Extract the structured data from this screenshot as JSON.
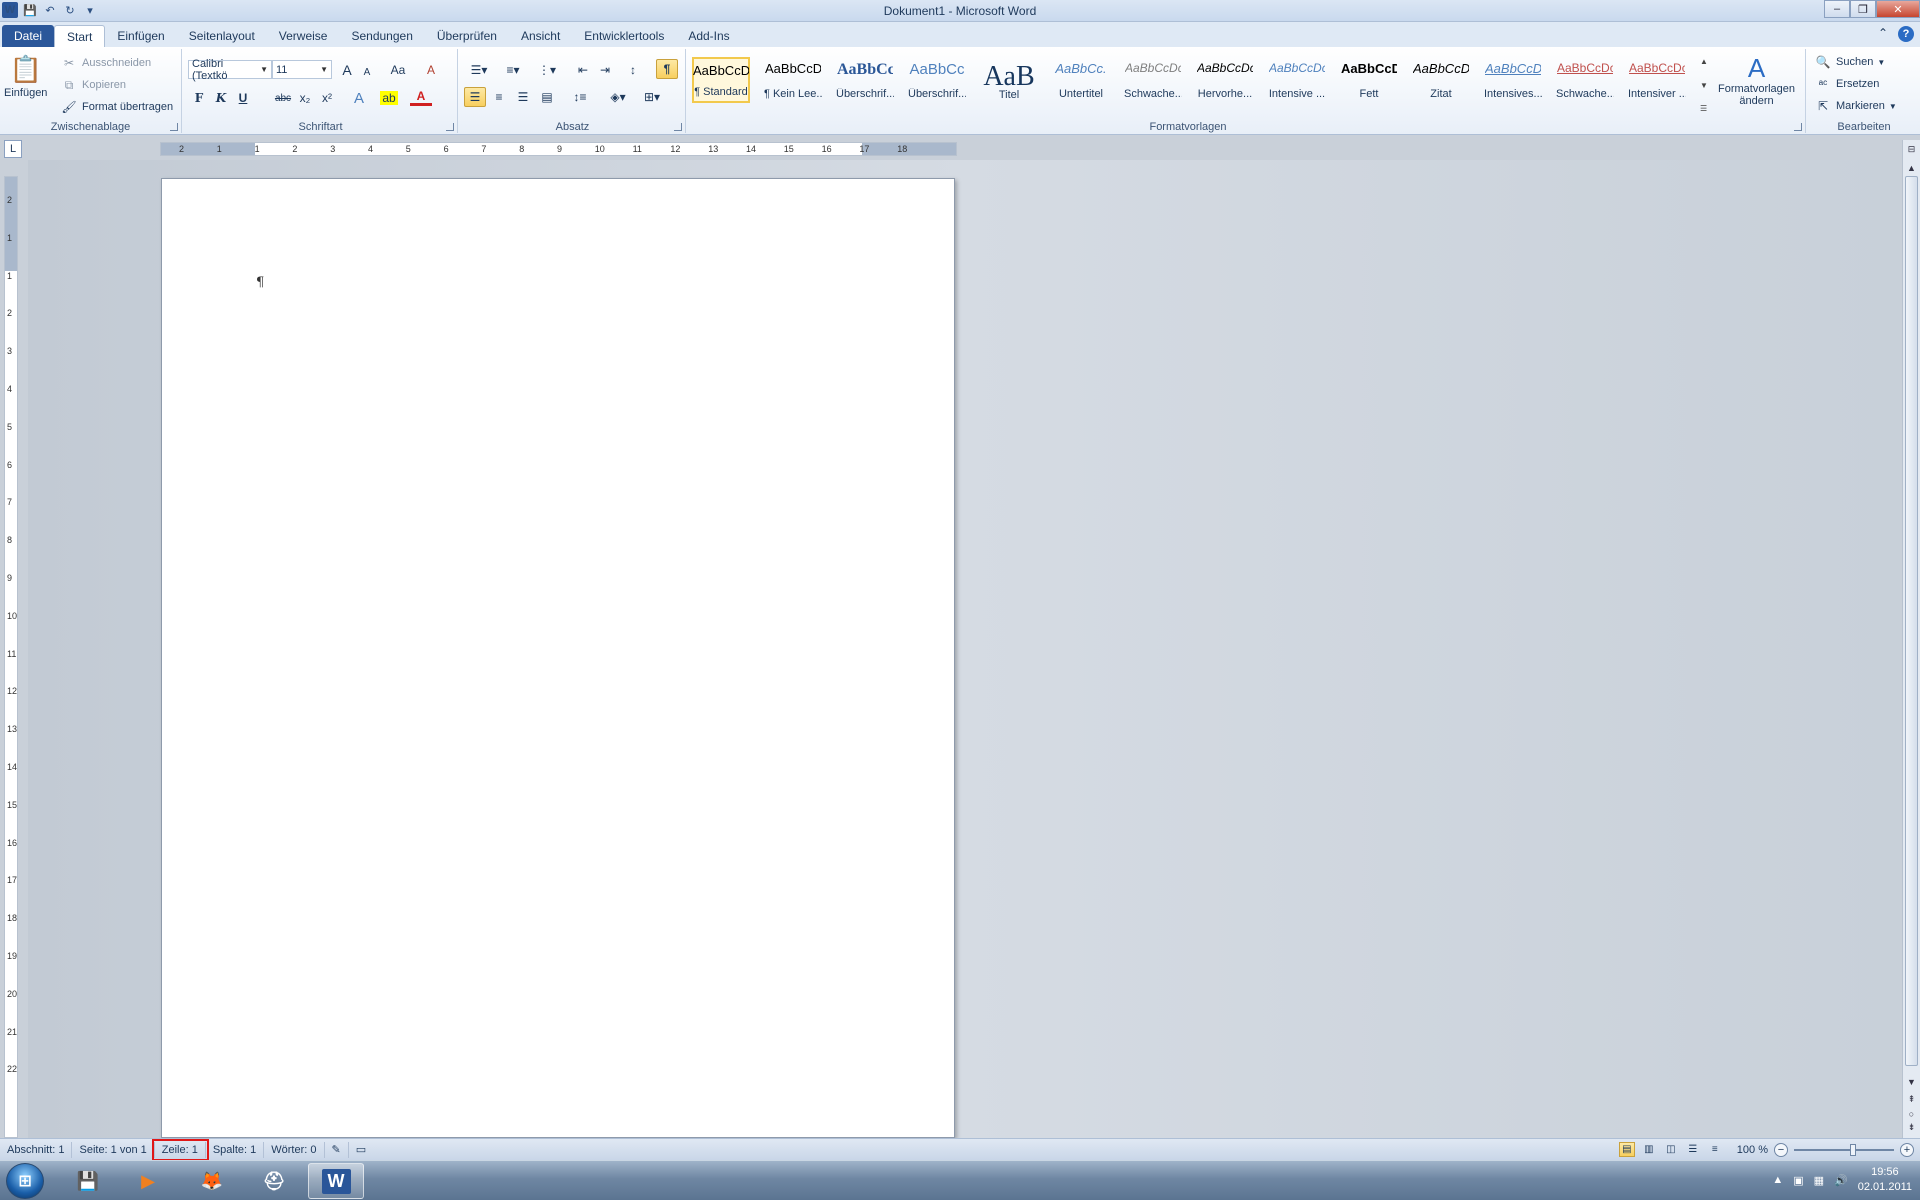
{
  "window": {
    "title": "Dokument1 - Microsoft Word",
    "minimize": "–",
    "maximize": "❐",
    "close": "✕"
  },
  "qat": {
    "word_logo": "W",
    "save_icon": "💾",
    "undo_icon": "↶",
    "redo_icon": "↻",
    "customize_icon": "▾"
  },
  "tabs": [
    {
      "label": "Datei"
    },
    {
      "label": "Start"
    },
    {
      "label": "Einfügen"
    },
    {
      "label": "Seitenlayout"
    },
    {
      "label": "Verweise"
    },
    {
      "label": "Sendungen"
    },
    {
      "label": "Überprüfen"
    },
    {
      "label": "Ansicht"
    },
    {
      "label": "Entwicklertools"
    },
    {
      "label": "Add-Ins"
    }
  ],
  "help": "?",
  "ribbon": {
    "clipboard": {
      "label": "Zwischenablage",
      "paste": "Einfügen",
      "cut": "Ausschneiden",
      "copy": "Kopieren",
      "format_painter": "Format übertragen"
    },
    "font": {
      "label": "Schriftart",
      "font_name": "Calibri (Textkö",
      "font_size": "11",
      "bold": "F",
      "italic": "K",
      "underline": "U",
      "strike": "abc",
      "subscript": "x₂",
      "superscript": "x²",
      "grow": "A",
      "shrink": "A",
      "case": "Aa",
      "clear": "A"
    },
    "paragraph": {
      "label": "Absatz",
      "pilcrow": "¶"
    },
    "styles": {
      "label": "Formatvorlagen",
      "items": [
        {
          "sample": "AaBbCcDc",
          "name": "¶ Standard",
          "color": "#000000"
        },
        {
          "sample": "AaBbCcDc",
          "name": "¶ Kein Lee...",
          "color": "#000000"
        },
        {
          "sample": "AaBbCc",
          "name": "Überschrif...",
          "color": "#2b5797"
        },
        {
          "sample": "AaBbCc",
          "name": "Überschrif...",
          "color": "#4f81bd"
        },
        {
          "sample": "AaB",
          "name": "Titel",
          "color": "#17365d"
        },
        {
          "sample": "AaBbCc.",
          "name": "Untertitel",
          "color": "#4f81bd"
        },
        {
          "sample": "AaBbCcDc",
          "name": "Schwache...",
          "color": "#7f7f7f"
        },
        {
          "sample": "AaBbCcDc",
          "name": "Hervorhe...",
          "color": "#000000"
        },
        {
          "sample": "AaBbCcDc",
          "name": "Intensive ...",
          "color": "#4f81bd"
        },
        {
          "sample": "AaBbCcDc",
          "name": "Fett",
          "color": "#000000"
        },
        {
          "sample": "AaBbCcDc",
          "name": "Zitat",
          "color": "#000000"
        },
        {
          "sample": "AaBbCcDc",
          "name": "Intensives...",
          "color": "#4f81bd"
        },
        {
          "sample": "AaBbCcDc",
          "name": "Schwache...",
          "color": "#c0504d"
        },
        {
          "sample": "AaBbCcDc",
          "name": "Intensiver ...",
          "color": "#c0504d"
        }
      ],
      "change_label_1": "Formatvorlagen",
      "change_label_2": "ändern"
    },
    "editing": {
      "label": "Bearbeiten",
      "find": "Suchen",
      "replace": "Ersetzen",
      "select": "Markieren"
    }
  },
  "ruler": {
    "corner": "L",
    "h_ticks": [
      "2",
      "1",
      "1",
      "2",
      "3",
      "4",
      "5",
      "6",
      "7",
      "8",
      "9",
      "10",
      "11",
      "12",
      "13",
      "14",
      "15",
      "16",
      "17",
      "18"
    ],
    "v_ticks": [
      "2",
      "1",
      "1",
      "2",
      "3",
      "4",
      "5",
      "6",
      "7",
      "8",
      "9",
      "10",
      "11",
      "12",
      "13",
      "14",
      "15",
      "16",
      "17",
      "18",
      "19",
      "20",
      "21",
      "22"
    ]
  },
  "document": {
    "pilcrow": "¶"
  },
  "statusbar": {
    "section": "Abschnitt: 1",
    "page": "Seite: 1 von 1",
    "line": "Zeile: 1",
    "column": "Spalte: 1",
    "words": "Wörter: 0",
    "zoom": "100 %",
    "zoom_level_percent": 100
  },
  "taskbar": {
    "start": "⊞",
    "apps": [
      {
        "name": "save-app",
        "glyph": "💾"
      },
      {
        "name": "media-app",
        "glyph": "▶"
      },
      {
        "name": "firefox-app",
        "glyph": "🦊"
      },
      {
        "name": "helmet-app",
        "glyph": "⛑"
      },
      {
        "name": "word-app",
        "glyph": "W"
      }
    ],
    "time": "19:56",
    "date": "02.01.2011"
  },
  "colors": {
    "accent": "#2b579a",
    "highlight": "#e01818",
    "selected_style": "#f2c94c"
  }
}
